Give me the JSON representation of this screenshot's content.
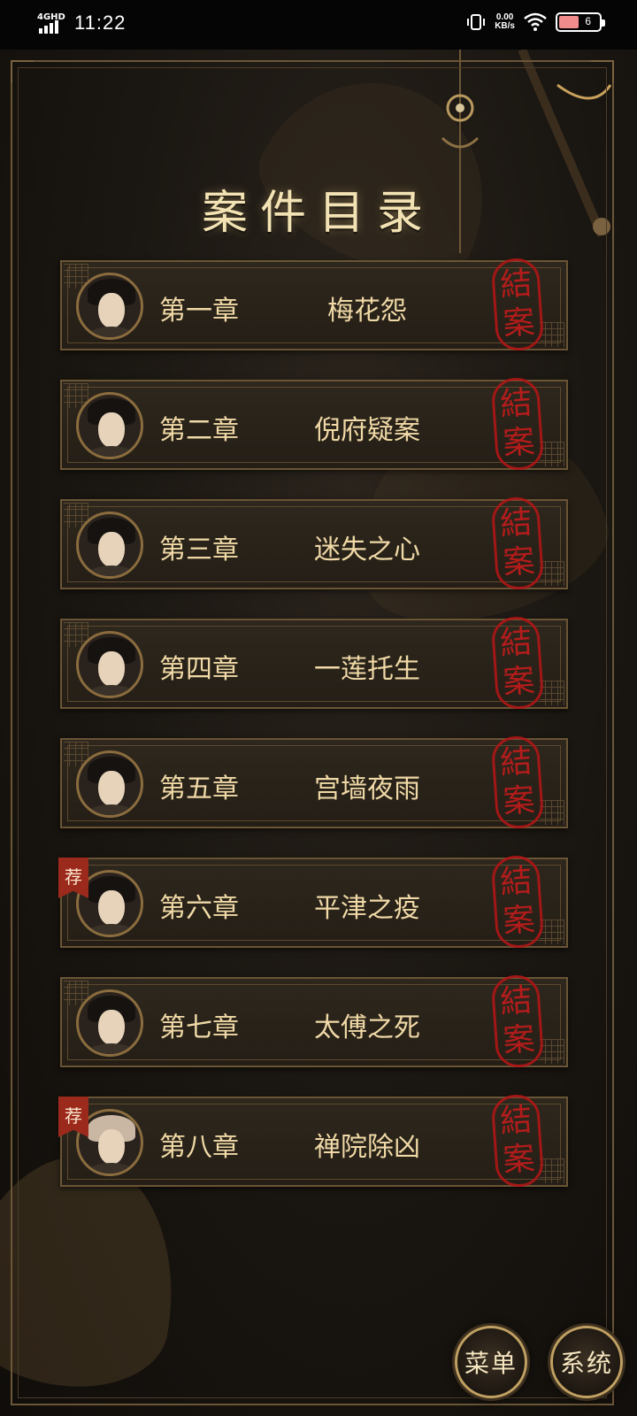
{
  "status": {
    "network": "4GHD",
    "time": "11:22",
    "speed_value": "0.00",
    "speed_unit": "KB/s",
    "battery_level": "6"
  },
  "page": {
    "title": "案件目录"
  },
  "chapters": [
    {
      "number": "第一章",
      "title": "梅花怨",
      "stamp": [
        "結",
        "案"
      ],
      "recommended": false
    },
    {
      "number": "第二章",
      "title": "倪府疑案",
      "stamp": [
        "結",
        "案"
      ],
      "recommended": false
    },
    {
      "number": "第三章",
      "title": "迷失之心",
      "stamp": [
        "結",
        "案"
      ],
      "recommended": false
    },
    {
      "number": "第四章",
      "title": "一莲托生",
      "stamp": [
        "結",
        "案"
      ],
      "recommended": false
    },
    {
      "number": "第五章",
      "title": "宫墙夜雨",
      "stamp": [
        "結",
        "案"
      ],
      "recommended": false
    },
    {
      "number": "第六章",
      "title": "平津之疫",
      "stamp": [
        "結",
        "案"
      ],
      "recommended": true,
      "badge": "荐"
    },
    {
      "number": "第七章",
      "title": "太傅之死",
      "stamp": [
        "結",
        "案"
      ],
      "recommended": false
    },
    {
      "number": "第八章",
      "title": "禅院除凶",
      "stamp": [
        "結",
        "案"
      ],
      "recommended": true,
      "badge": "荐"
    }
  ],
  "buttons": {
    "menu": "菜单",
    "system": "系统"
  },
  "colors": {
    "gold": "#e8cf9a",
    "stamp_red": "#c41c1c",
    "badge_red": "#9c2a1c",
    "frame": "#6a5535"
  }
}
